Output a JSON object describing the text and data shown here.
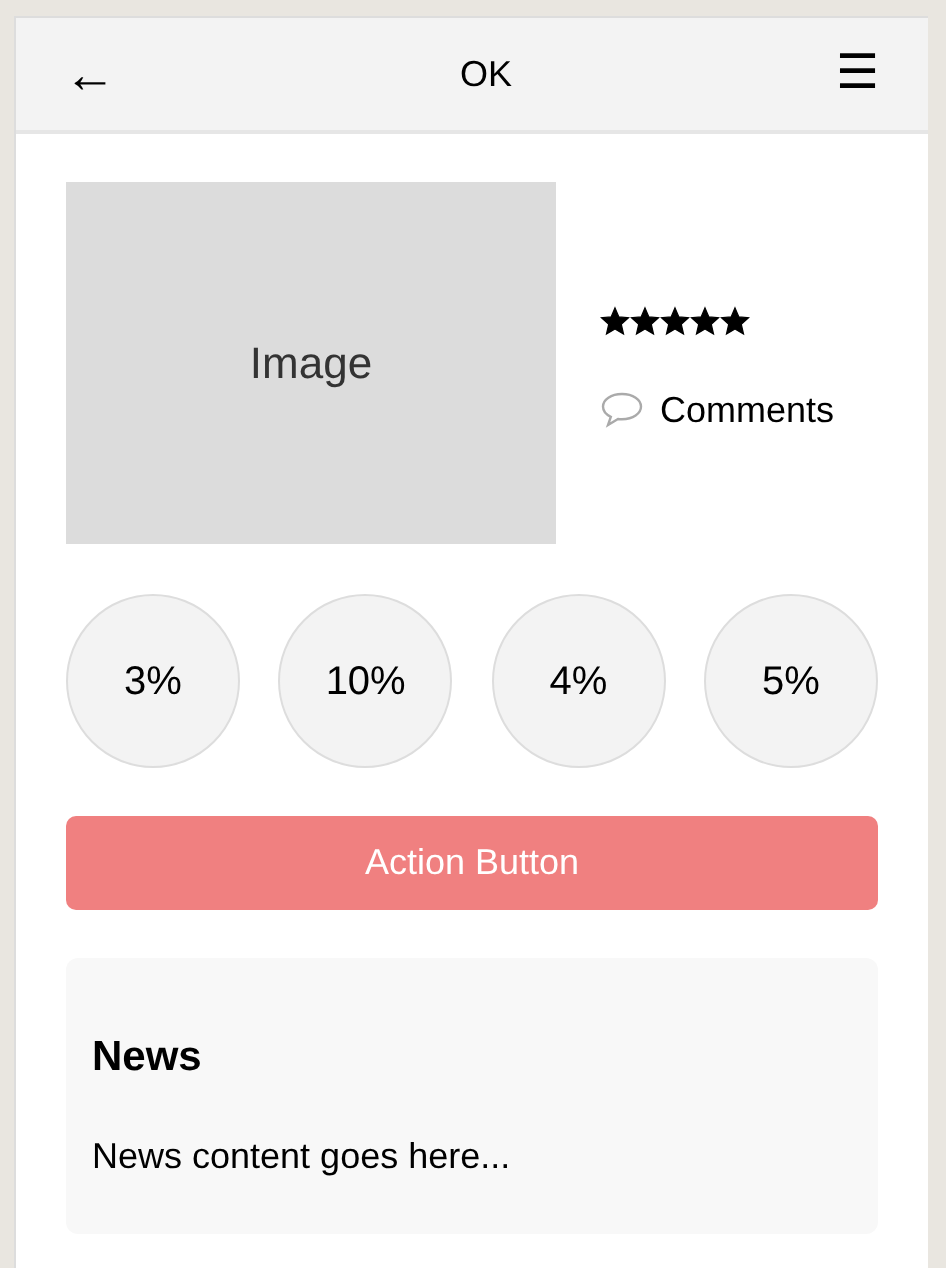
{
  "header": {
    "back": "←",
    "title": "OK",
    "menu": "☰"
  },
  "media": {
    "image_label": "Image",
    "stars": 5,
    "comments": "Comments"
  },
  "stats": [
    "3%",
    "10%",
    "4%",
    "5%"
  ],
  "action_button": "Action Button",
  "news": {
    "title": "News",
    "body": "News content goes here..."
  }
}
